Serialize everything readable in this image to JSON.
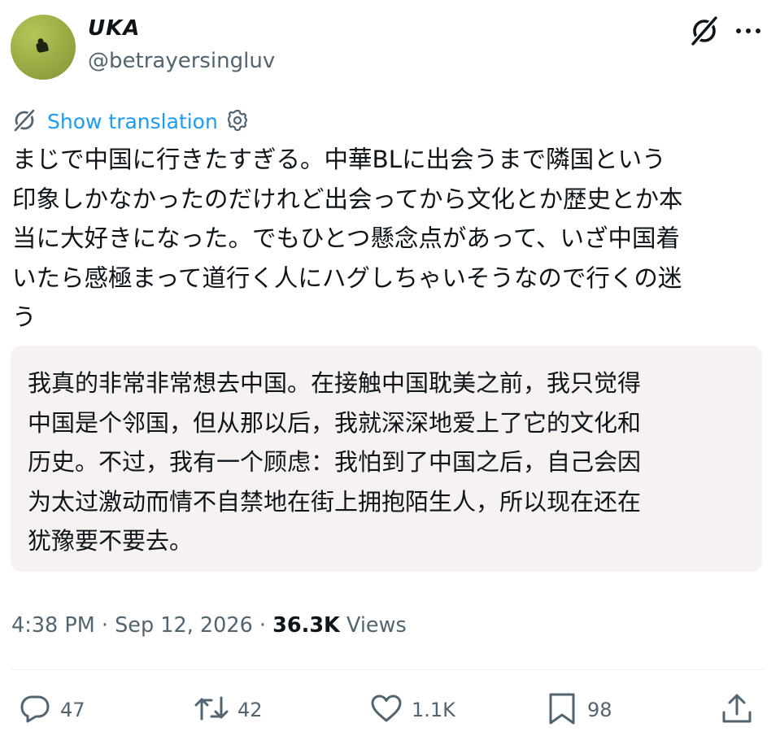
{
  "author": {
    "display_name": "UKA",
    "handle": "@betrayersingluv"
  },
  "header_icons": [
    "grok-icon",
    "more-icon"
  ],
  "translation": {
    "link_label": "Show translation"
  },
  "tweet": {
    "text": "まじで中国に行きたすぎる。中華BLに出会うまで隣国という\n印象しかなかったのだけれど出会ってから文化とか歴史とか本\n当に大好きになった。でもひとつ懸念点があって、いざ中国着\nいたら感極まって道行く人にハグしちゃいそうなので行くの迷\nう",
    "translated_text": "我真的非常非常想去中国。在接触中国耽美之前，我只觉得\n中国是个邻国，但从那以后，我就深深地爱上了它的文化和\n历史。不过，我有一个顾虑：我怕到了中国之后，自己会因\n为太过激动而情不自禁地在街上拥抱陌生人，所以现在还在\n犹豫要不要去。"
  },
  "meta": {
    "time": "4:38 PM",
    "sep1": " · ",
    "date": "Sep 12, 2026",
    "sep2": " · ",
    "views_count": "36.3K",
    "views_label": " Views"
  },
  "actions": {
    "replies": "47",
    "reposts": "42",
    "likes": "1.1K",
    "bookmarks": "98"
  },
  "colors": {
    "link": "#1d9bf0",
    "secondary_text": "#536471",
    "primary_text": "#0f1419",
    "translation_bg": "#f7f2f2"
  }
}
